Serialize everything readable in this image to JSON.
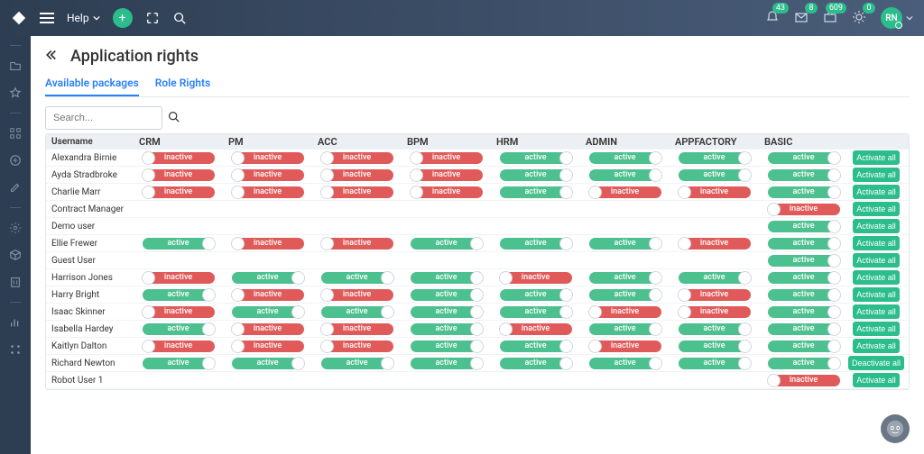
{
  "topbar": {
    "help": "Help",
    "notif_bell": "43",
    "notif_mail": "8",
    "notif_case": "609",
    "notif_sun": "0",
    "avatar": "RN"
  },
  "page": {
    "title": "Application rights",
    "tab1": "Available packages",
    "tab2": "Role Rights",
    "search_placeholder": "Search..."
  },
  "columns": [
    "Username",
    "CRM",
    "PM",
    "ACC",
    "BPM",
    "HRM",
    "ADMIN",
    "APPFACTORY",
    "BASIC"
  ],
  "labels": {
    "active": "active",
    "inactive": "inactive",
    "activate_all": "Activate all",
    "deactivate_all": "Deactivate all"
  },
  "rows": [
    {
      "u": "Alexandra Birnie",
      "m": [
        "i",
        "i",
        "i",
        "i",
        "a",
        "a",
        "a",
        "a"
      ],
      "b": "a"
    },
    {
      "u": "Ayda Stradbroke",
      "m": [
        "i",
        "i",
        "i",
        "i",
        "a",
        "a",
        "a",
        "a"
      ],
      "b": "a"
    },
    {
      "u": "Charlie Marr",
      "m": [
        "i",
        "i",
        "i",
        "i",
        "a",
        "i",
        "i",
        "a"
      ],
      "b": "a"
    },
    {
      "u": "Contract Manager",
      "m": [
        "",
        "",
        "",
        "",
        "",
        "",
        "",
        "i"
      ],
      "b": "a"
    },
    {
      "u": "Demo user",
      "m": [
        "",
        "",
        "",
        "",
        "",
        "",
        "",
        "a"
      ],
      "b": "a"
    },
    {
      "u": "Ellie Frewer",
      "m": [
        "a",
        "i",
        "i",
        "a",
        "a",
        "a",
        "i",
        "a"
      ],
      "b": "a"
    },
    {
      "u": "Guest User",
      "m": [
        "",
        "",
        "",
        "",
        "",
        "",
        "",
        "a"
      ],
      "b": "a"
    },
    {
      "u": "Harrison Jones",
      "m": [
        "i",
        "a",
        "a",
        "a",
        "i",
        "a",
        "a",
        "a"
      ],
      "b": "a"
    },
    {
      "u": "Harry Bright",
      "m": [
        "a",
        "i",
        "i",
        "a",
        "a",
        "a",
        "i",
        "a"
      ],
      "b": "a"
    },
    {
      "u": "Isaac Skinner",
      "m": [
        "i",
        "a",
        "a",
        "a",
        "a",
        "i",
        "i",
        "a"
      ],
      "b": "a"
    },
    {
      "u": "Isabella Hardey",
      "m": [
        "a",
        "i",
        "i",
        "a",
        "i",
        "a",
        "a",
        "a"
      ],
      "b": "a"
    },
    {
      "u": "Kaitlyn Dalton",
      "m": [
        "i",
        "i",
        "i",
        "a",
        "a",
        "i",
        "a",
        "a"
      ],
      "b": "a"
    },
    {
      "u": "Richard Newton",
      "m": [
        "a",
        "a",
        "a",
        "a",
        "a",
        "a",
        "a",
        "a"
      ],
      "b": "d"
    },
    {
      "u": "Robot User 1",
      "m": [
        "",
        "",
        "",
        "",
        "",
        "",
        "",
        "i"
      ],
      "b": "a"
    }
  ]
}
